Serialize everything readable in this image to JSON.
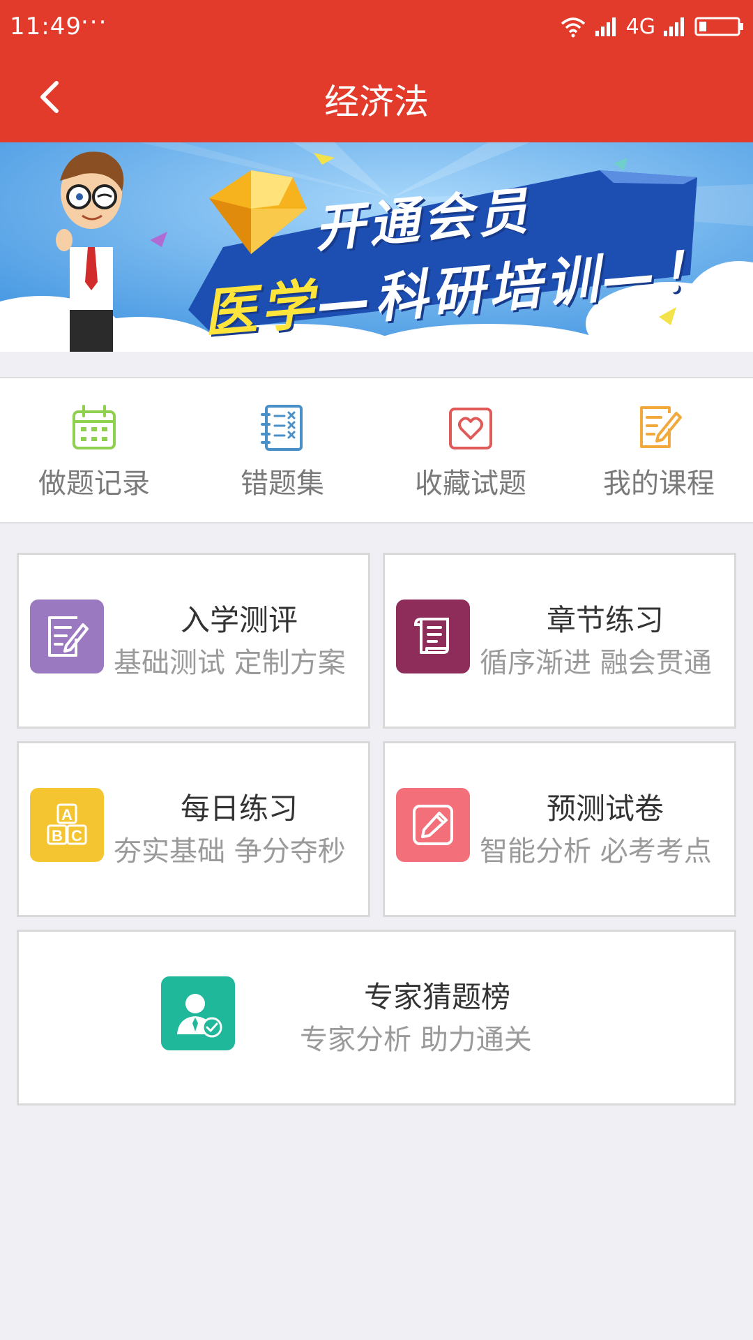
{
  "status_bar": {
    "time": "11:49",
    "dots": "···",
    "network": "4G"
  },
  "nav": {
    "title": "经济法",
    "back_icon": "chevron-left-icon"
  },
  "banner": {
    "line1": "开通会员",
    "line2_highlight": "医学",
    "line2_rest": "—科研培训—！"
  },
  "quick_links": [
    {
      "label": "做题记录",
      "icon": "calendar-icon",
      "color": "#8fd14f"
    },
    {
      "label": "错题集",
      "icon": "notebook-icon",
      "color": "#4a90c8"
    },
    {
      "label": "收藏试题",
      "icon": "heart-icon",
      "color": "#e05a5a"
    },
    {
      "label": "我的课程",
      "icon": "edit-note-icon",
      "color": "#f2a93b"
    }
  ],
  "cards": [
    {
      "title": "入学测评",
      "subtitle": "基础测试 定制方案",
      "icon": "document-edit-icon",
      "color": "#9b79c0"
    },
    {
      "title": "章节练习",
      "subtitle": "循序渐进 融会贯通",
      "icon": "scroll-icon",
      "color": "#8e2d5a"
    },
    {
      "title": "每日练习",
      "subtitle": "夯实基础 争分夺秒",
      "icon": "abc-blocks-icon",
      "color": "#f5c431"
    },
    {
      "title": "预测试卷",
      "subtitle": "智能分析 必考考点",
      "icon": "pencil-icon",
      "color": "#f36f7a"
    },
    {
      "title": "专家猜题榜",
      "subtitle": "专家分析 助力通关",
      "icon": "expert-icon",
      "color": "#1fb89a"
    }
  ]
}
